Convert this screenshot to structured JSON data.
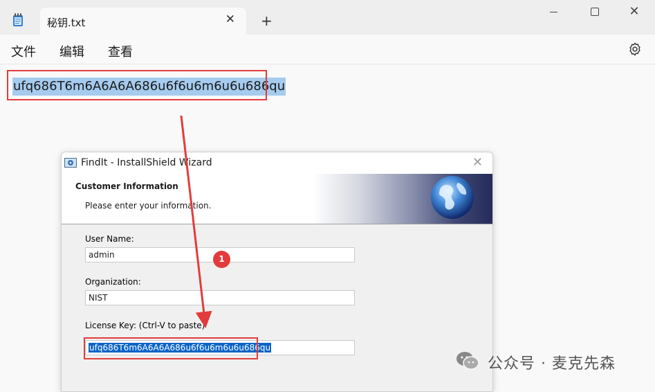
{
  "notepad": {
    "tab_title": "秘钥.txt",
    "tab_close": "✕",
    "new_tab": "+",
    "menu": {
      "file": "文件",
      "edit": "编辑",
      "view": "查看"
    },
    "content": "ufq686T6m6A6A6A686u6f6u6m6u6u686qu"
  },
  "dialog": {
    "title": "FindIt - InstallShield Wizard",
    "close": "✕",
    "header_title": "Customer Information",
    "header_subtitle": "Please enter your information.",
    "user_name_label": "User Name:",
    "user_name_value": "admin",
    "organization_label": "Organization:",
    "organization_value": "NIST",
    "license_label": "License Key: (Ctrl-V to paste)",
    "license_value": "ufq686T6m6A6A6A686u6f6u6m6u6u686qu"
  },
  "annotation": {
    "step": "1"
  },
  "watermark": {
    "text": "公众号 · 麦克先森"
  },
  "colors": {
    "highlight_box": "#e33b3b",
    "selection_notepad": "#a5cbee",
    "selection_dialog": "#0a64c6"
  }
}
